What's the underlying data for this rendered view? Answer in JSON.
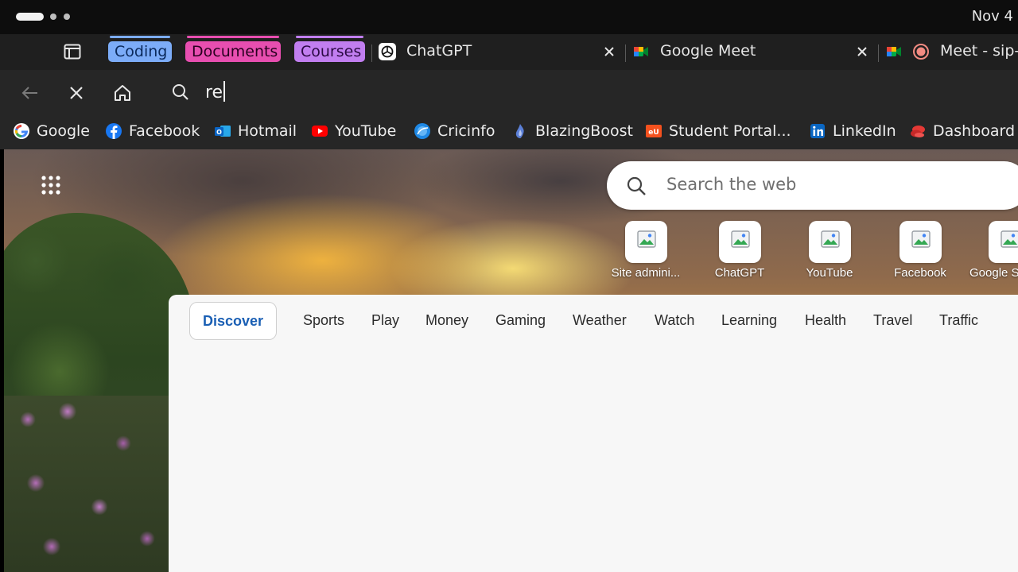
{
  "system": {
    "clock": "Nov 4"
  },
  "tabs": {
    "groups": [
      {
        "label": "Coding",
        "color": "#7cacf8"
      },
      {
        "label": "Documents",
        "color": "#e74eb0"
      },
      {
        "label": "Courses",
        "color": "#c17ef0"
      }
    ],
    "items": [
      {
        "title": "ChatGPT",
        "icon": "openai-icon"
      },
      {
        "title": "Google Meet",
        "icon": "google-meet-icon"
      },
      {
        "title": "Meet - sip-x",
        "icon": "google-meet-icon"
      }
    ]
  },
  "toolbar": {
    "omnibox_value": "re"
  },
  "bookmarks": [
    {
      "label": "Google",
      "icon": "google-icon"
    },
    {
      "label": "Facebook",
      "icon": "facebook-icon"
    },
    {
      "label": "Hotmail",
      "icon": "outlook-icon"
    },
    {
      "label": "YouTube",
      "icon": "youtube-icon"
    },
    {
      "label": "Cricinfo",
      "icon": "cricinfo-icon"
    },
    {
      "label": "BlazingBoost",
      "icon": "blazingboost-icon"
    },
    {
      "label": "Student Portal...",
      "icon": "student-portal-icon"
    },
    {
      "label": "LinkedIn",
      "icon": "linkedin-icon"
    },
    {
      "label": "Dashboard",
      "icon": "dashboard-icon"
    }
  ],
  "newtab": {
    "search_placeholder": "Search the web",
    "shortcuts": [
      {
        "label": "Site admini..."
      },
      {
        "label": "ChatGPT"
      },
      {
        "label": "YouTube"
      },
      {
        "label": "Facebook"
      },
      {
        "label": "Google S"
      }
    ],
    "feed_tabs": [
      "Discover",
      "Sports",
      "Play",
      "Money",
      "Gaming",
      "Weather",
      "Watch",
      "Learning",
      "Health",
      "Travel",
      "Traffic"
    ]
  }
}
